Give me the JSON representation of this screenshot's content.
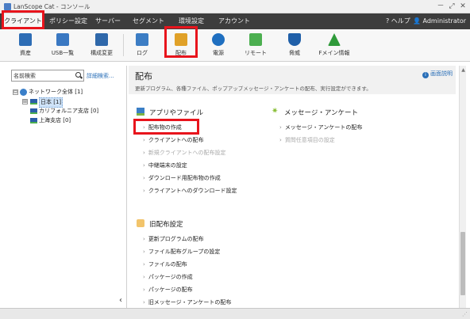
{
  "window": {
    "title": "LanScope Cat - コンソール",
    "minimize": "－",
    "maximize": "⤢",
    "close": "✕"
  },
  "menubar": {
    "items": [
      "クライアント",
      "ポリシー設定",
      "サーバー",
      "セグメント",
      "環境設定",
      "アカウント"
    ],
    "active_index": 0,
    "help": "ヘルプ",
    "user": "Administrator"
  },
  "toolbar": {
    "items": [
      {
        "label": "資産",
        "icon": "asset-icon",
        "color": "#2d6db5"
      },
      {
        "label": "USB一覧",
        "icon": "usb-icon",
        "color": "#3a78c2"
      },
      {
        "label": "構成変更",
        "icon": "config-change-icon",
        "color": "#2f68aa"
      },
      {
        "label": "ログ",
        "icon": "log-icon",
        "color": "#3c7dc4"
      },
      {
        "label": "配布",
        "icon": "distribution-icon",
        "color": "#e0a128"
      },
      {
        "label": "電源",
        "icon": "power-icon",
        "color": "#1f6fc0"
      },
      {
        "label": "リモート",
        "icon": "remote-icon",
        "color": "#4caf50"
      },
      {
        "label": "脅威",
        "icon": "shield-icon",
        "color": "#1f5fa8"
      },
      {
        "label": "Fメイン情報",
        "icon": "domain-info-icon",
        "color": "#2f9a3a"
      }
    ]
  },
  "sidebar": {
    "search_placeholder": "名前検索",
    "advanced_search": "詳細検索...",
    "tree": [
      {
        "label": "ネットワーク全体 [1]",
        "level": 0,
        "toggle": "⊟"
      },
      {
        "label": "日本 [1]",
        "level": 1,
        "toggle": "⊞",
        "selected": true
      },
      {
        "label": "カリフォルニア支店 [0]",
        "level": 1
      },
      {
        "label": "上海支店 [0]",
        "level": 1
      }
    ],
    "collapse": "‹"
  },
  "content": {
    "title": "配布",
    "description": "更新プログラム、各種ファイル、ポップアップメッセージ・アンケートの配布、実行設定ができます。",
    "help": "画面説明",
    "sections": [
      {
        "title": "アプリやファイル",
        "links": [
          {
            "label": "配布物の作成",
            "enabled": true
          },
          {
            "label": "クライアントへの配布",
            "enabled": true
          },
          {
            "label": "新規クライアントへの配布設定",
            "enabled": false
          },
          {
            "label": "中継端末の設定",
            "enabled": true
          },
          {
            "label": "ダウンロード用配布物の作成",
            "enabled": true
          },
          {
            "label": "クライアントへのダウンロード設定",
            "enabled": true
          }
        ]
      },
      {
        "title": "メッセージ・アンケート",
        "links": [
          {
            "label": "メッセージ・アンケートの配布",
            "enabled": true
          },
          {
            "label": "質問任意項目の設定",
            "enabled": false
          }
        ]
      },
      {
        "title": "旧配布設定",
        "links": [
          {
            "label": "更新プログラムの配布",
            "enabled": true
          },
          {
            "label": "ファイル配布グループの設定",
            "enabled": true
          },
          {
            "label": "ファイルの配布",
            "enabled": true
          },
          {
            "label": "パッケージの作成",
            "enabled": true
          },
          {
            "label": "パッケージの配布",
            "enabled": true
          },
          {
            "label": "旧メッセージ・アンケートの配布",
            "enabled": true
          }
        ]
      }
    ]
  },
  "colors": {
    "menubar_bg": "#3d3d3d",
    "highlight": "#e8141c",
    "link": "#2a6fb8"
  }
}
